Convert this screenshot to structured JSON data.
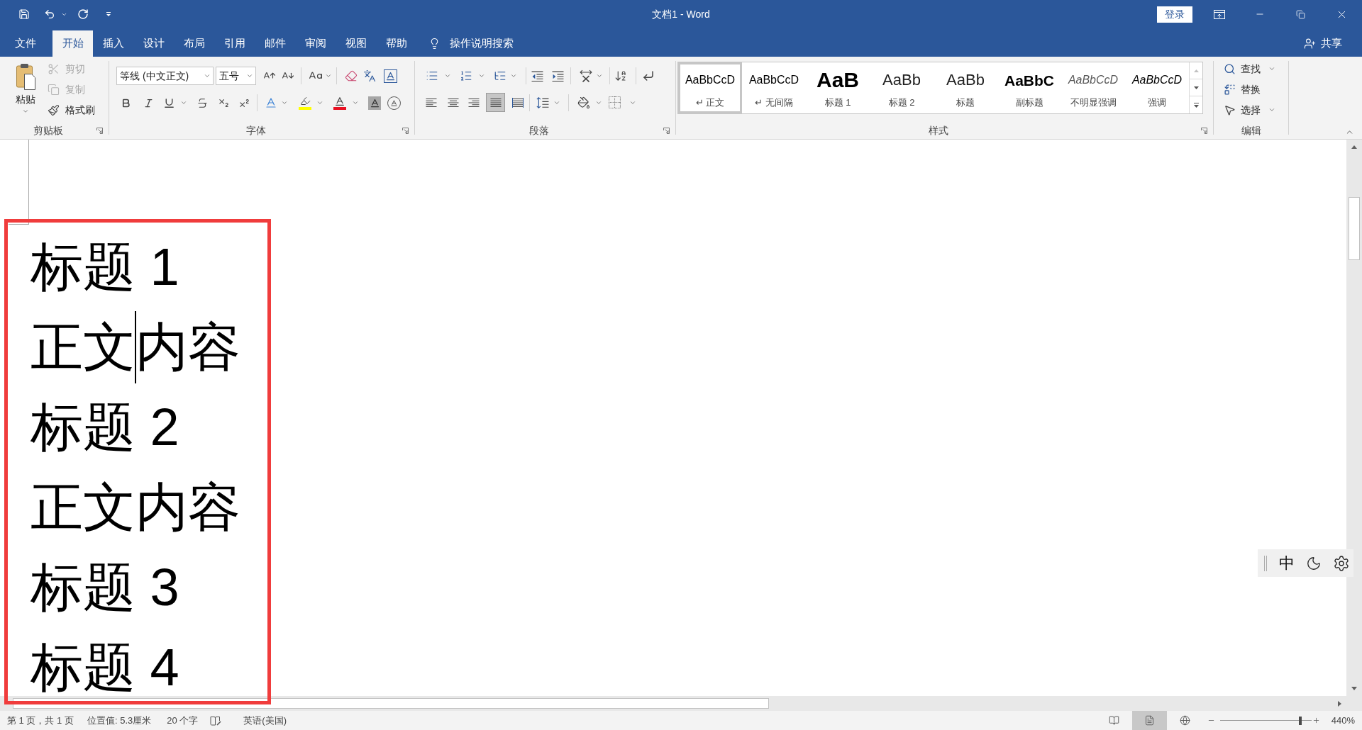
{
  "window": {
    "title": "文档1 - Word",
    "sign_in": "登录"
  },
  "tabs": [
    {
      "label": "文件",
      "selected": false
    },
    {
      "label": "开始",
      "selected": true
    },
    {
      "label": "插入",
      "selected": false
    },
    {
      "label": "设计",
      "selected": false
    },
    {
      "label": "布局",
      "selected": false
    },
    {
      "label": "引用",
      "selected": false
    },
    {
      "label": "邮件",
      "selected": false
    },
    {
      "label": "审阅",
      "selected": false
    },
    {
      "label": "视图",
      "selected": false
    },
    {
      "label": "帮助",
      "selected": false
    }
  ],
  "tell_me": "操作说明搜索",
  "share": "共享",
  "ribbon": {
    "clipboard": {
      "label": "剪贴板",
      "paste": "粘贴",
      "commands": [
        {
          "kind": "cut",
          "label": "剪切",
          "disabled": true
        },
        {
          "kind": "copy",
          "label": "复制",
          "disabled": true
        },
        {
          "kind": "format_painter",
          "label": "格式刷",
          "disabled": false
        }
      ]
    },
    "font": {
      "label": "字体",
      "font_name": "等线 (中文正文)",
      "font_size": "五号"
    },
    "paragraph": {
      "label": "段落",
      "alignment": [
        {
          "kind": "left",
          "selected": false
        },
        {
          "kind": "center",
          "selected": false
        },
        {
          "kind": "right",
          "selected": false
        },
        {
          "kind": "justify",
          "selected": true
        },
        {
          "kind": "distributed",
          "selected": false
        }
      ]
    },
    "styles": {
      "label": "样式",
      "items": [
        {
          "kind": "normal",
          "preview": "AaBbCcD",
          "name": "↵ 正文",
          "selected": true
        },
        {
          "kind": "no_spacing",
          "preview": "AaBbCcD",
          "name": "↵ 无间隔",
          "selected": false
        },
        {
          "kind": "heading1",
          "preview": "AaB",
          "name": "标题 1",
          "selected": false
        },
        {
          "kind": "heading2",
          "preview": "AaBb",
          "name": "标题 2",
          "selected": false
        },
        {
          "kind": "title",
          "preview": "AaBb",
          "name": "标题",
          "selected": false
        },
        {
          "kind": "subtitle",
          "preview": "AaBbC",
          "name": "副标题",
          "selected": false
        },
        {
          "kind": "subtle_emphasis",
          "preview": "AaBbCcD",
          "name": "不明显强调",
          "selected": false
        },
        {
          "kind": "emphasis",
          "preview": "AaBbCcD",
          "name": "强调",
          "selected": false
        }
      ]
    },
    "editing": {
      "label": "编辑",
      "commands": [
        {
          "kind": "find",
          "label": "查找",
          "dropdown": true
        },
        {
          "kind": "replace",
          "label": "替换",
          "dropdown": false
        },
        {
          "kind": "select",
          "label": "选择",
          "dropdown": true
        }
      ]
    }
  },
  "document": {
    "paragraphs": [
      {
        "runs": [
          {
            "text": "标题 1",
            "caret_after": false
          }
        ]
      },
      {
        "runs": [
          {
            "text": "正文",
            "caret_after": true
          },
          {
            "text": "内容",
            "caret_after": false
          }
        ]
      },
      {
        "runs": [
          {
            "text": "标题 2",
            "caret_after": false
          }
        ]
      },
      {
        "runs": [
          {
            "text": "正文内容",
            "caret_after": false
          }
        ]
      },
      {
        "runs": [
          {
            "text": "标题 3",
            "caret_after": false
          }
        ]
      },
      {
        "runs": [
          {
            "text": "标题 4",
            "caret_after": false
          }
        ]
      }
    ]
  },
  "ime": {
    "mode": "中"
  },
  "status_bar": {
    "page": "第 1 页，共 1 页",
    "position": "位置值: 5.3厘米",
    "word_count": "20 个字",
    "language": "英语(美国)",
    "views": [
      {
        "kind": "read",
        "selected": false
      },
      {
        "kind": "print",
        "selected": true
      },
      {
        "kind": "web",
        "selected": false
      }
    ],
    "zoom": {
      "level": 0.88,
      "reading": "440%"
    }
  }
}
